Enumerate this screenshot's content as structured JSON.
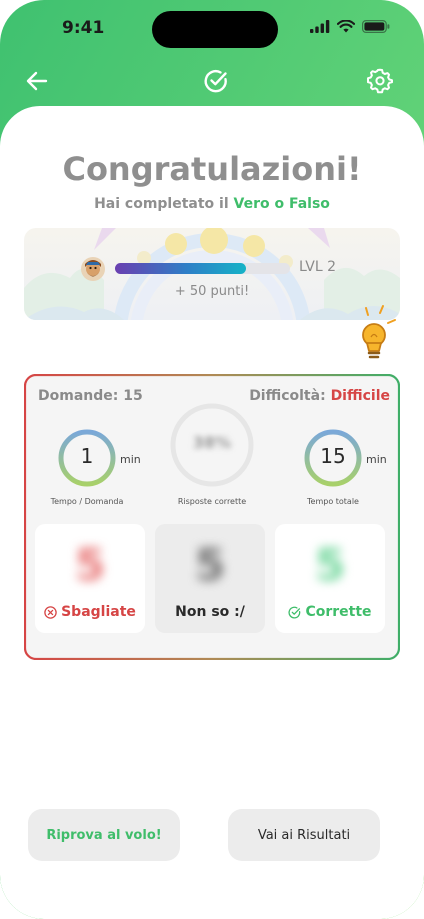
{
  "status_bar": {
    "time": "9:41",
    "icons": [
      "signal-icon",
      "wifi-icon",
      "battery-icon"
    ]
  },
  "nav": {
    "back_icon": "arrow-left-icon",
    "center_icon": "check-circle-icon",
    "settings_icon": "gear-icon"
  },
  "header": {
    "title": "Congratulazioni!",
    "subtitle_prefix": "Hai completato il ",
    "subtitle_game": "Vero o Falso"
  },
  "level": {
    "label": "LVL 2",
    "points": "+ 50 punti!",
    "progress_percent": 75
  },
  "stats": {
    "questions_label": "Domande:",
    "questions_value": "15",
    "difficulty_label": "Difficoltà:",
    "difficulty_value": "Difficile",
    "time_per_question": {
      "value": "1",
      "unit": "min",
      "caption": "Tempo / Domanda"
    },
    "correct_answers": {
      "value": "38%",
      "caption": "Risposte corrette"
    },
    "total_time": {
      "value": "15",
      "unit": "min",
      "caption": "Tempo totale"
    },
    "tiles": [
      {
        "count": "5",
        "label": "Sbagliate",
        "icon": "x-circle-icon"
      },
      {
        "count": "5",
        "label": "Non so :/"
      },
      {
        "count": "5",
        "label": "Corrette",
        "icon": "check-circle-icon"
      }
    ]
  },
  "buttons": {
    "retry": "Riprova al volo!",
    "results": "Vai ai Risultati"
  },
  "colors": {
    "green_accent": "#3fbd6a",
    "red_accent": "#d64545",
    "header_gradient_start": "#3fc170",
    "header_gradient_end": "#86df73"
  }
}
